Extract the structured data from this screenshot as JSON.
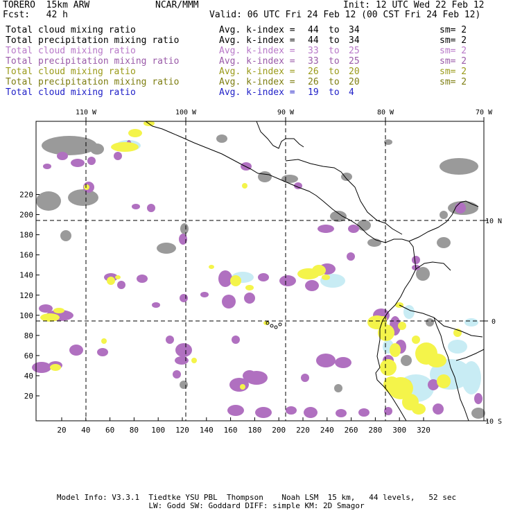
{
  "header": {
    "model": "TORERO  15km ARW",
    "org": "NCAR/MMM",
    "init": "Init: 12 UTC Wed 22 Feb 12",
    "fcst": "Fcst:   42 h",
    "valid": "Valid: 06 UTC Fri 24 Feb 12 (00 CST Fri 24 Feb 12)"
  },
  "legend": [
    {
      "field": "Total cloud mixing ratio",
      "avg": "Avg. k-index =",
      "k1": "44",
      "to": "to",
      "k2": "34",
      "sm": "sm= 2",
      "color": "#000000"
    },
    {
      "field": "Total precipitation mixing ratio",
      "avg": "Avg. k-index =",
      "k1": "44",
      "to": "to",
      "k2": "34",
      "sm": "sm= 2",
      "color": "#000000"
    },
    {
      "field": "Total cloud mixing ratio",
      "avg": "Avg. k-index =",
      "k1": "33",
      "to": "to",
      "k2": "25",
      "sm": "sm= 2",
      "color": "#b878c8"
    },
    {
      "field": "Total precipitation mixing ratio",
      "avg": "Avg. k-index =",
      "k1": "33",
      "to": "to",
      "k2": "25",
      "sm": "sm= 2",
      "color": "#9a5aa8"
    },
    {
      "field": "Total cloud mixing ratio",
      "avg": "Avg. k-index =",
      "k1": "26",
      "to": "to",
      "k2": "20",
      "sm": "sm= 2",
      "color": "#9a9a18"
    },
    {
      "field": "Total precipitation mixing ratio",
      "avg": "Avg. k-index =",
      "k1": "26",
      "to": "to",
      "k2": "20",
      "sm": "sm= 2",
      "color": "#7d7d10"
    },
    {
      "field": "Total cloud mixing ratio",
      "avg": "Avg. k-index =",
      "k1": "19",
      "to": "to",
      "k2": "4",
      "sm": "",
      "color": "#2020c8"
    }
  ],
  "map": {
    "top_lon_labels": [
      "110 W",
      "100 W",
      "90 W",
      "80 W",
      "70 W"
    ],
    "right_lat_labels": [
      "10 N",
      "0",
      "10 S"
    ],
    "y_ticks": [
      "20",
      "40",
      "60",
      "80",
      "100",
      "120",
      "140",
      "160",
      "180",
      "200",
      "220"
    ],
    "x_ticks": [
      "20",
      "40",
      "60",
      "80",
      "100",
      "120",
      "140",
      "160",
      "180",
      "200",
      "220",
      "240",
      "260",
      "280",
      "300",
      "320"
    ],
    "colors": {
      "gray": "#9a9a9a",
      "purple": "#b070c0",
      "yellow": "#f4f44a",
      "lightblue": "#c8ecf4"
    }
  },
  "footer": {
    "line1": "Model Info: V3.3.1  Tiedtke YSU PBL  Thompson    Noah LSM  15 km,   44 levels,   52 sec",
    "line2": "LW: Godd SW: Goddard DIFF: simple KM: 2D Smagor"
  }
}
